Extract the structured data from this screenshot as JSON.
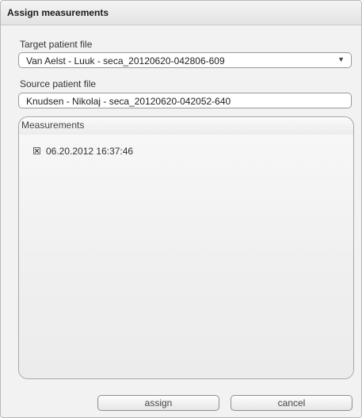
{
  "dialog": {
    "title": "Assign measurements"
  },
  "target": {
    "label": "Target patient file",
    "value": "Van Aelst - Luuk - seca_20120620-042806-609",
    "chevron": "▼"
  },
  "source": {
    "label": "Source patient file",
    "value": "Knudsen - Nikolaj - seca_20120620-042052-640"
  },
  "measurements": {
    "label": "Measurements",
    "items": [
      {
        "label": "06.20.2012 16:37:46",
        "checked": true
      }
    ]
  },
  "buttons": {
    "assign": "assign",
    "cancel": "cancel"
  }
}
